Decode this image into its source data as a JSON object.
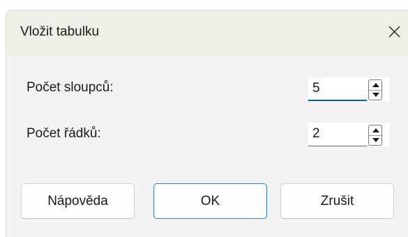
{
  "dialog": {
    "title": "Vložit tabulku",
    "close_icon": "close-icon"
  },
  "fields": {
    "columns": {
      "label": "Počet sloupců:",
      "value": "5"
    },
    "rows": {
      "label": "Počet řádků:",
      "value": "2"
    }
  },
  "buttons": {
    "help": "Nápověda",
    "ok": "OK",
    "cancel": "Zrušit"
  },
  "colors": {
    "titlebar": "#eef0e7",
    "body": "#f3f3f3",
    "accent": "#005fb8"
  }
}
